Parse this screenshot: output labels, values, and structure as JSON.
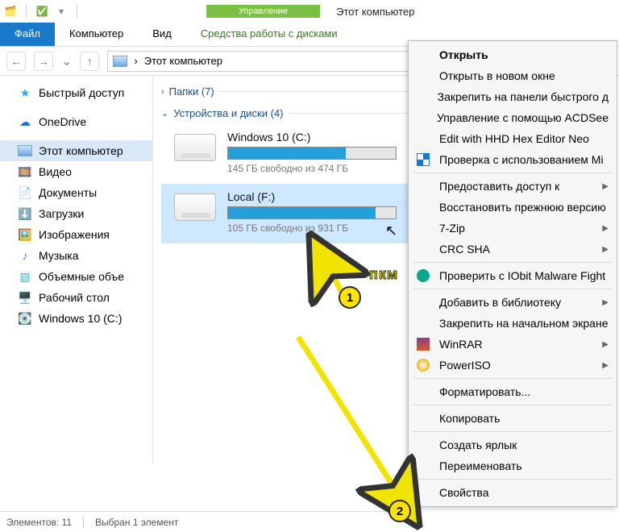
{
  "title": "Этот компьютер",
  "mgmt_tab": "Управление",
  "ribbon": {
    "file": "Файл",
    "computer": "Компьютер",
    "view": "Вид",
    "disk_tools": "Средства работы с дисками"
  },
  "address": {
    "location": "Этот компьютер",
    "sep": "›"
  },
  "sidebar": {
    "quick": "Быстрый доступ",
    "onedrive": "OneDrive",
    "thispc": "Этот компьютер",
    "video": "Видео",
    "docs": "Документы",
    "dl": "Загрузки",
    "pics": "Изображения",
    "music": "Музыка",
    "obj3d": "Объемные объе",
    "desktop": "Рабочий стол",
    "drive_c": "Windows 10 (C:)"
  },
  "groups": {
    "folders": "Папки (7)",
    "devices": "Устройства и диски (4)"
  },
  "drives": {
    "c": {
      "name": "Windows 10 (C:)",
      "free": "145 ГБ свободно из 474 ГБ",
      "fill_pct": 70
    },
    "f": {
      "name": "Local (F:)",
      "free": "105 ГБ свободно из 931 ГБ",
      "fill_pct": 88
    }
  },
  "status": {
    "count": "Элементов: 11",
    "sel": "Выбран 1 элемент"
  },
  "ctx": {
    "open": "Открыть",
    "open_new": "Открыть в новом окне",
    "pin_quick": "Закрепить на панели быстрого д",
    "acdsee": "Управление с помощью ACDSee",
    "hexeditor": "Edit with HHD Hex Editor Neo",
    "defender": "Проверка с использованием Mi",
    "give_access": "Предоставить доступ к",
    "prev_ver": "Восстановить прежнюю версию",
    "sevenzip": "7-Zip",
    "crcsha": "CRC SHA",
    "iobit": "Проверить с IObit Malware Fight",
    "addlib": "Добавить в библиотеку",
    "pin_start": "Закрепить на начальном экране",
    "winrar": "WinRAR",
    "poweriso": "PowerISO",
    "format": "Форматировать...",
    "copy": "Копировать",
    "shortcut": "Создать ярлык",
    "rename": "Переименовать",
    "props": "Свойства"
  },
  "anno": {
    "b1": "1",
    "b2": "2",
    "nkm": "пкм"
  }
}
